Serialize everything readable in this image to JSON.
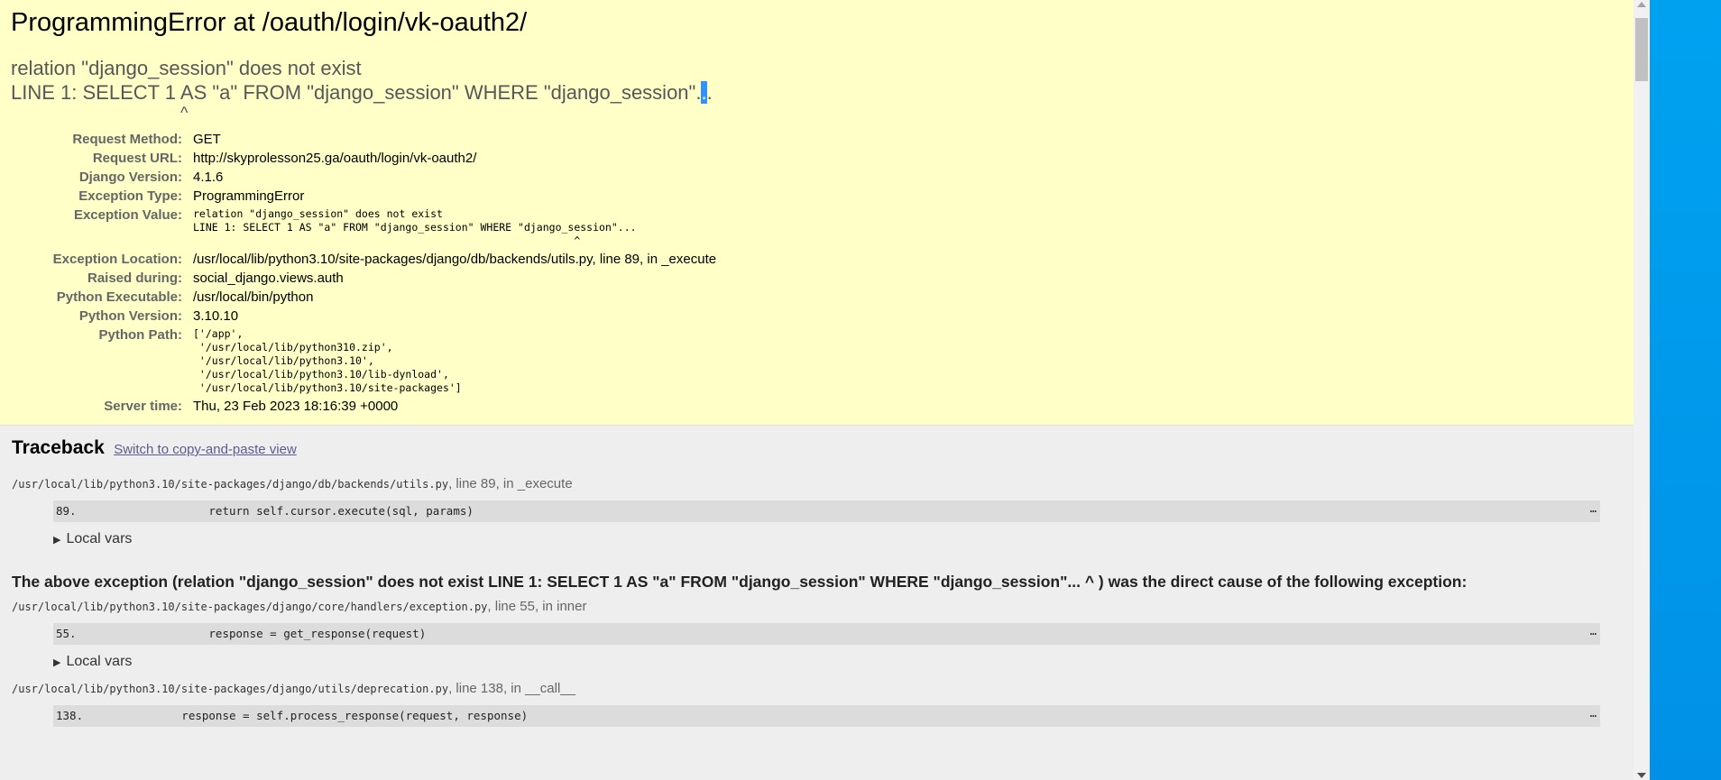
{
  "title": "ProgrammingError at /oauth/login/vk-oauth2/",
  "exception_value": {
    "line1": "relation \"django_session\" does not exist",
    "line2_prefix": "LINE 1: SELECT 1 AS \"a\" FROM \"django_session\" WHERE \"django_session\".",
    "line2_selected": ".",
    "line2_suffix": ".",
    "caret": "^"
  },
  "meta": {
    "request_method_label": "Request Method:",
    "request_method": "GET",
    "request_url_label": "Request URL:",
    "request_url": "http://skyprolesson25.ga/oauth/login/vk-oauth2/",
    "django_version_label": "Django Version:",
    "django_version": "4.1.6",
    "exception_type_label": "Exception Type:",
    "exception_type": "ProgrammingError",
    "exception_value_label": "Exception Value:",
    "exception_value": "relation \"django_session\" does not exist\nLINE 1: SELECT 1 AS \"a\" FROM \"django_session\" WHERE \"django_session\"...\n                                                             ^",
    "exception_location_label": "Exception Location:",
    "exception_location": "/usr/local/lib/python3.10/site-packages/django/db/backends/utils.py, line 89, in _execute",
    "raised_during_label": "Raised during:",
    "raised_during": "social_django.views.auth",
    "python_executable_label": "Python Executable:",
    "python_executable": "/usr/local/bin/python",
    "python_version_label": "Python Version:",
    "python_version": "3.10.10",
    "python_path_label": "Python Path:",
    "python_path": "['/app',\n '/usr/local/lib/python310.zip',\n '/usr/local/lib/python3.10',\n '/usr/local/lib/python3.10/lib-dynload',\n '/usr/local/lib/python3.10/site-packages']",
    "server_time_label": "Server time:",
    "server_time": "Thu, 23 Feb 2023 18:16:39 +0000"
  },
  "traceback": {
    "heading": "Traceback",
    "switch_link": "Switch to copy-and-paste view",
    "local_vars_label": "Local vars",
    "frames": [
      {
        "file": "/usr/local/lib/python3.10/site-packages/django/db/backends/utils.py",
        "location": ", line 89, in _execute",
        "line_no": "89.",
        "code": "                return self.cursor.execute(sql, params)"
      },
      {
        "file": "/usr/local/lib/python3.10/site-packages/django/core/handlers/exception.py",
        "location": ", line 55, in inner",
        "line_no": "55.",
        "code": "                response = get_response(request)"
      },
      {
        "file": "/usr/local/lib/python3.10/site-packages/django/utils/deprecation.py",
        "location": ", line 138, in __call__",
        "line_no": "138.",
        "code": "            response = self.process_response(request, response)"
      }
    ],
    "cause": "The above exception (relation \"django_session\" does not exist LINE 1: SELECT 1 AS \"a\" FROM \"django_session\" WHERE \"django_session\"... ^ ) was the direct cause of the following exception:",
    "ellipsis": "…"
  }
}
